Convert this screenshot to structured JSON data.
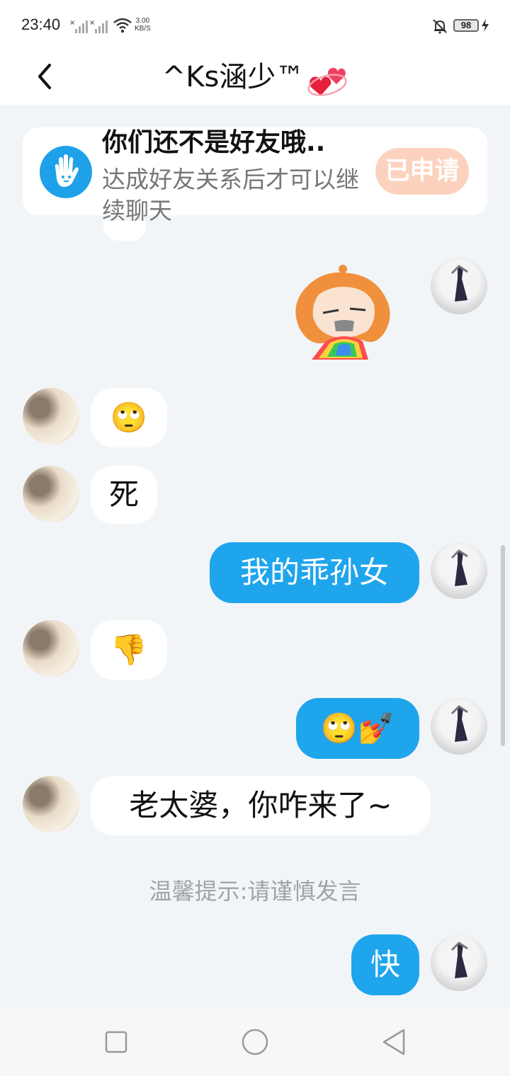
{
  "status_bar": {
    "time": "23:40",
    "net_speed_value": "3.00",
    "net_speed_unit": "KB/S",
    "battery": "98"
  },
  "header": {
    "title": "^Ks涵少™",
    "back_icon": "chevron-left-icon",
    "heart_icon": "revolving-hearts-icon"
  },
  "notice": {
    "title": "你们还不是好友哦..",
    "description": "达成好友关系后才可以继续聊天",
    "button_label": "已申请",
    "icon": "waving-hand-icon"
  },
  "messages": [
    {
      "side": "out",
      "type": "sticker",
      "content": "rainbow-vomit-sticker"
    },
    {
      "side": "in",
      "type": "emoji",
      "content": "🙄"
    },
    {
      "side": "in",
      "type": "text",
      "content": "死"
    },
    {
      "side": "out",
      "type": "text",
      "content": "我的乖孙女"
    },
    {
      "side": "in",
      "type": "emoji",
      "content": "👎"
    },
    {
      "side": "out",
      "type": "emoji",
      "content": "🙄💅"
    },
    {
      "side": "in",
      "type": "text",
      "content": "老太婆，你咋来了~"
    },
    {
      "side": "out",
      "type": "text",
      "content": "快"
    }
  ],
  "tip": "温馨提示:请谨慎发言",
  "colors": {
    "outgoing_bubble": "#1fa5ec",
    "incoming_bubble": "#ffffff",
    "background": "#f2f5f8",
    "apply_button": "#fcd2bf"
  }
}
